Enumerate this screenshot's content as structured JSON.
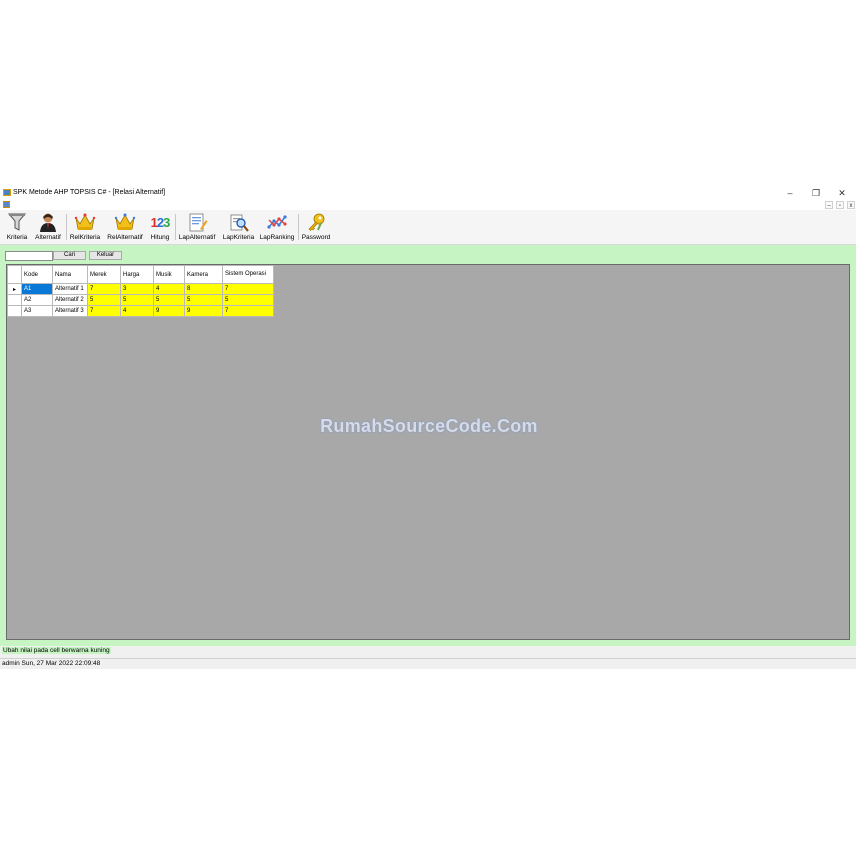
{
  "window": {
    "title": "SPK Metode AHP TOPSIS C# - [Relasi Alternatif]",
    "controls": {
      "minimize": "–",
      "restore": "❐",
      "close": "✕"
    },
    "child_controls": {
      "minimize": "–",
      "restore": "▫",
      "close": "x"
    }
  },
  "toolbar": {
    "items": [
      {
        "label": "Kriteria",
        "icon": "funnel-icon"
      },
      {
        "label": "Alternatif",
        "icon": "user-icon"
      },
      {
        "label": "RelKriteria",
        "icon": "crown-icon"
      },
      {
        "label": "RelAlternatif",
        "icon": "crown-icon"
      },
      {
        "label": "Hitung",
        "icon": "numbers-123-icon",
        "icon_text": "123"
      },
      {
        "label": "LapAlternatif",
        "icon": "report-icon"
      },
      {
        "label": "LapKriteria",
        "icon": "search-report-icon"
      },
      {
        "label": "LapRanking",
        "icon": "chart-icon"
      },
      {
        "label": "Password",
        "icon": "key-icon"
      }
    ]
  },
  "search": {
    "value": "",
    "cari_label": "Cari",
    "keluar_label": "Keluar"
  },
  "grid": {
    "columns": [
      "Kode",
      "Nama",
      "Merek",
      "Harga",
      "Musik",
      "Kamera",
      "Sistem Operasi"
    ],
    "row_indicator": "▸",
    "rows": [
      {
        "kode": "A1",
        "nama": "Alternatif 1",
        "values": [
          "7",
          "3",
          "4",
          "8",
          "7"
        ]
      },
      {
        "kode": "A2",
        "nama": "Alternatif 2",
        "values": [
          "5",
          "5",
          "5",
          "5",
          "5"
        ]
      },
      {
        "kode": "A3",
        "nama": "Alternatif 3",
        "values": [
          "7",
          "4",
          "9",
          "9",
          "7"
        ]
      }
    ]
  },
  "watermark": "RumahSourceCode.Com",
  "status": {
    "hint": "Ubah nilai pada cell berwarna kuning",
    "user_time": "admin Sun, 27 Mar 2022 22:09:48"
  },
  "colors": {
    "client_bg": "#c6f4c2",
    "editable_cell": "#ffff00",
    "selected_cell": "#0a78d7",
    "grid_bg": "#a8a8a8"
  }
}
